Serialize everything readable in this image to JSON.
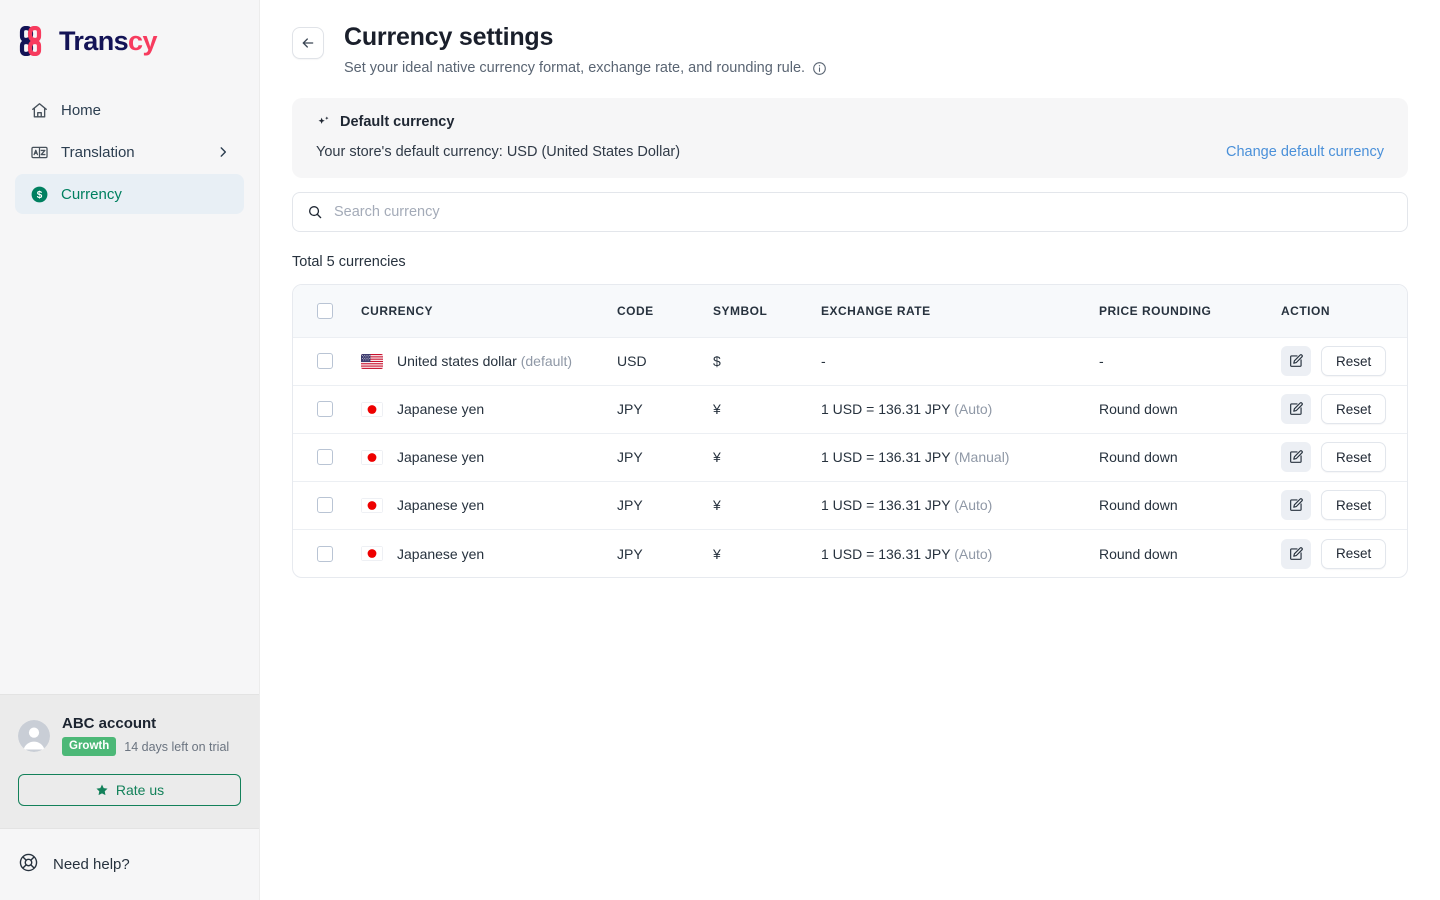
{
  "brand": {
    "name_part1": "Trans",
    "name_part2": "cy",
    "navy": "#131356",
    "pink": "#f73b5e"
  },
  "sidebar": {
    "items": [
      {
        "label": "Home",
        "icon": "home-icon",
        "active": false,
        "chevron": false
      },
      {
        "label": "Translation",
        "icon": "translation-icon",
        "active": false,
        "chevron": true
      },
      {
        "label": "Currency",
        "icon": "currency-dollar-icon",
        "active": true,
        "chevron": false
      }
    ],
    "account": {
      "name": "ABC account",
      "plan_badge": "Growth",
      "trial_text": "14 days left on trial",
      "rate_button": "Rate us"
    },
    "help": {
      "label": "Need help?",
      "icon": "lifebuoy-icon"
    },
    "accent_green": "#008060",
    "badge_green": "#4cb877"
  },
  "header": {
    "back_icon": "arrow-left-icon",
    "title": "Currency settings",
    "subtitle": "Set your ideal native currency format, exchange rate, and rounding rule.",
    "info_icon": "info-circle-icon"
  },
  "default_banner": {
    "icon": "sparkle-icon",
    "title": "Default currency",
    "text": "Your store's default currency: USD (United States Dollar)",
    "link": "Change default currency",
    "link_color": "#4a90d9"
  },
  "search": {
    "icon": "search-icon",
    "placeholder": "Search currency",
    "value": ""
  },
  "total_label": "Total 5 currencies",
  "table": {
    "columns": [
      "CURRENCY",
      "CODE",
      "SYMBOL",
      "EXCHANGE RATE",
      "PRICE ROUNDING",
      "ACTION"
    ],
    "edit_icon": "edit-pencil-square-icon",
    "reset_label": "Reset",
    "rows": [
      {
        "flag": "us-flag",
        "currency": "United states dollar",
        "currency_note": "(default)",
        "code": "USD",
        "symbol": "$",
        "rate": "-",
        "rate_mode": "",
        "rounding": "-",
        "selected": false
      },
      {
        "flag": "jp-flag",
        "currency": "Japanese yen",
        "currency_note": "",
        "code": "JPY",
        "symbol": "¥",
        "rate": "1 USD = 136.31 JPY",
        "rate_mode": "(Auto)",
        "rounding": "Round down",
        "selected": false
      },
      {
        "flag": "jp-flag",
        "currency": "Japanese yen",
        "currency_note": "",
        "code": "JPY",
        "symbol": "¥",
        "rate": "1 USD = 136.31 JPY",
        "rate_mode": "(Manual)",
        "rounding": "Round down",
        "selected": false
      },
      {
        "flag": "jp-flag",
        "currency": "Japanese yen",
        "currency_note": "",
        "code": "JPY",
        "symbol": "¥",
        "rate": "1 USD = 136.31 JPY",
        "rate_mode": "(Auto)",
        "rounding": "Round down",
        "selected": false
      },
      {
        "flag": "jp-flag",
        "currency": "Japanese yen",
        "currency_note": "",
        "code": "JPY",
        "symbol": "¥",
        "rate": "1 USD = 136.31 JPY",
        "rate_mode": "(Auto)",
        "rounding": "Round down",
        "selected": false
      }
    ]
  }
}
